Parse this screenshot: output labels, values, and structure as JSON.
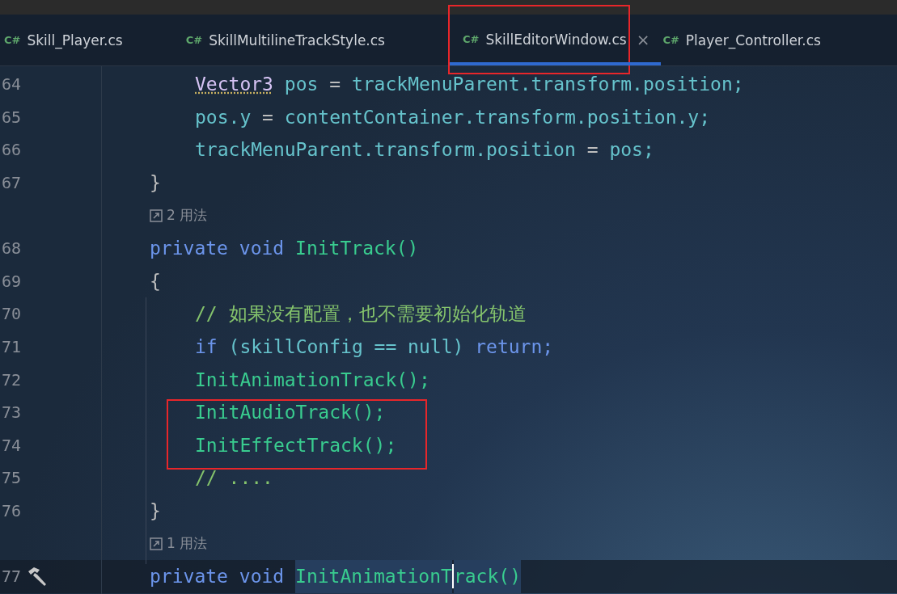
{
  "tabs": [
    {
      "lang": "C#",
      "label": "Skill_Player.cs",
      "selected": false
    },
    {
      "lang": "C#",
      "label": "SkillMultilineTrackStyle.cs",
      "selected": false
    },
    {
      "lang": "C#",
      "label": "SkillEditorWindow.cs",
      "selected": true,
      "outlined": true
    },
    {
      "lang": "C#",
      "label": "Player_Controller.cs",
      "selected": false
    }
  ],
  "close_glyph": "×",
  "lines": [
    {
      "kind": "statement",
      "number": "64",
      "tokens": [
        {
          "text": "Vector3",
          "kind": "type"
        },
        {
          "text": "pos",
          "kind": "ident"
        },
        {
          "text": "=",
          "kind": "punct"
        },
        {
          "text": "trackMenuParent.transform.position;",
          "kind": "ident"
        }
      ]
    },
    {
      "kind": "statement",
      "number": "65",
      "tokens": [
        {
          "text": "pos.y",
          "kind": "ident"
        },
        {
          "text": "=",
          "kind": "punct"
        },
        {
          "text": "contentContainer.transform.position.y;",
          "kind": "ident"
        }
      ]
    },
    {
      "kind": "statement",
      "number": "66",
      "tokens": [
        {
          "text": "trackMenuParent.transform.position",
          "kind": "ident"
        },
        {
          "text": "=",
          "kind": "punct"
        },
        {
          "text": "pos;",
          "kind": "ident"
        }
      ]
    },
    {
      "kind": "member",
      "number": "67",
      "tokens": [
        {
          "text": "}",
          "kind": "punct"
        }
      ]
    },
    {
      "kind": "usages",
      "text": "2 用法"
    },
    {
      "kind": "member",
      "number": "68",
      "tokens": [
        {
          "text": "private",
          "kind": "keyword"
        },
        {
          "text": "void",
          "kind": "keyword"
        },
        {
          "text": "InitTrack()",
          "kind": "method"
        }
      ]
    },
    {
      "kind": "member",
      "number": "69",
      "tokens": [
        {
          "text": "{",
          "kind": "punct"
        }
      ]
    },
    {
      "kind": "statement",
      "number": "70",
      "tokens": [
        {
          "text": "// 如果没有配置，也不需要初始化轨道",
          "kind": "comment"
        }
      ]
    },
    {
      "kind": "statement",
      "number": "71",
      "tokens": [
        {
          "text": "if",
          "kind": "keyword"
        },
        {
          "text": "(skillConfig == null)",
          "kind": "ident"
        },
        {
          "text": "return;",
          "kind": "keyword"
        }
      ]
    },
    {
      "kind": "statement",
      "number": "72",
      "tokens": [
        {
          "text": "InitAnimationTrack();",
          "kind": "method"
        }
      ]
    },
    {
      "kind": "statement",
      "number": "73",
      "outlined": true,
      "tokens": [
        {
          "text": "InitAudioTrack();",
          "kind": "method"
        }
      ]
    },
    {
      "kind": "statement",
      "number": "74",
      "outlined": true,
      "tokens": [
        {
          "text": "InitEffectTrack();",
          "kind": "method"
        }
      ]
    },
    {
      "kind": "statement",
      "number": "75",
      "tokens": [
        {
          "text": "// ....",
          "kind": "comment"
        }
      ]
    },
    {
      "kind": "member",
      "number": "76",
      "tokens": [
        {
          "text": "}",
          "kind": "punct"
        }
      ]
    },
    {
      "kind": "usages",
      "text": "1 用法"
    },
    {
      "kind": "member",
      "number": "77",
      "current": true,
      "tokens": [
        {
          "text": "private",
          "kind": "keyword"
        },
        {
          "text": "void",
          "kind": "keyword"
        },
        {
          "text": "InitAnimationT",
          "kind": "method",
          "highlighted": true,
          "caret_after": true
        },
        {
          "text": "rack()",
          "kind": "method",
          "highlighted": true
        }
      ]
    }
  ]
}
